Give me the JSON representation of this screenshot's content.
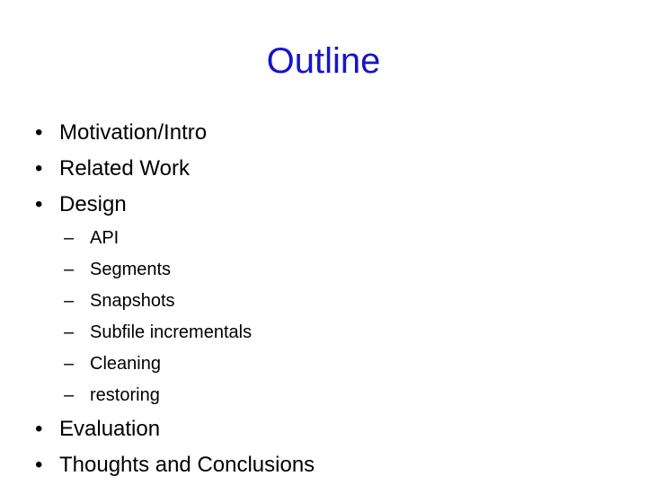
{
  "slide": {
    "title": "Outline",
    "title_color": "#1515c8",
    "text_color": "#000000",
    "background_color": "#ffffff",
    "level1_marker": "•",
    "level2_marker": "–",
    "outline": [
      {
        "label": "Motivation/Intro"
      },
      {
        "label": "Related Work"
      },
      {
        "label": "Design"
      },
      {
        "label": "Evaluation"
      },
      {
        "label": "Thoughts and Conclusions"
      }
    ],
    "design_subitems": [
      {
        "label": "API"
      },
      {
        "label": "Segments"
      },
      {
        "label": "Snapshots"
      },
      {
        "label": "Subfile incrementals"
      },
      {
        "label": "Cleaning"
      },
      {
        "label": "restoring"
      }
    ]
  }
}
